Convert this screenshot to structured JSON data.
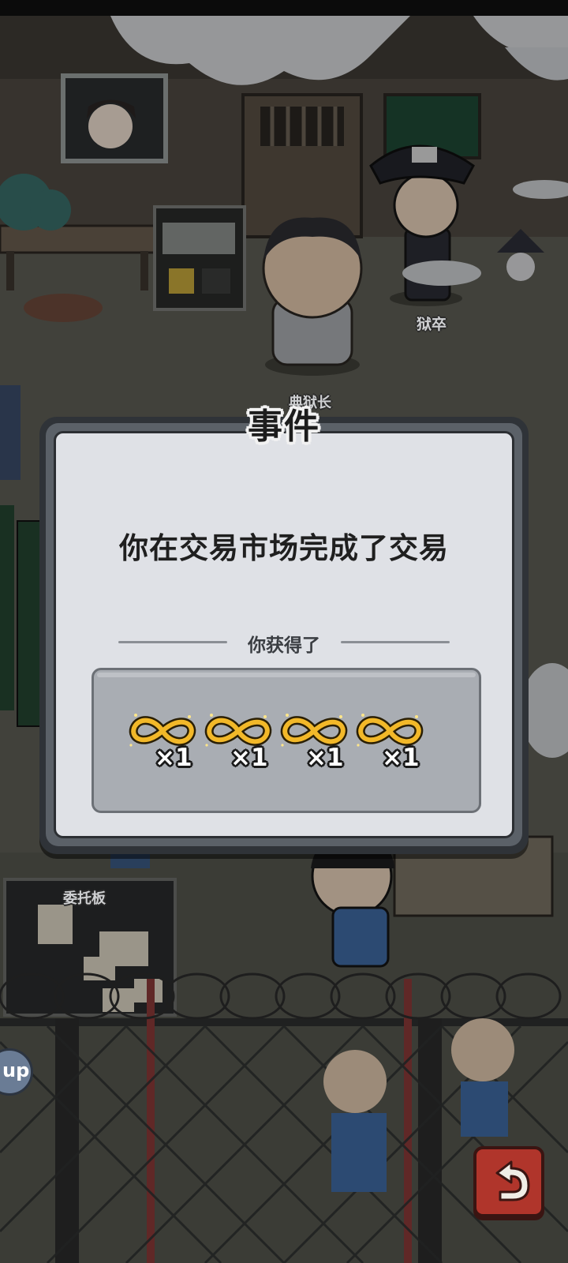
{
  "scene": {
    "guard_label": "狱卒",
    "warden_label": "典狱长",
    "board_label": "委托板",
    "up_button_label": "up"
  },
  "dialog": {
    "title": "事件",
    "message": "你在交易市场完成了交易",
    "reward_header": "你获得了",
    "rewards": [
      {
        "icon": "infinity-token-icon",
        "quantity": "×1"
      },
      {
        "icon": "infinity-token-icon",
        "quantity": "×1"
      },
      {
        "icon": "infinity-token-icon",
        "quantity": "×1"
      },
      {
        "icon": "infinity-token-icon",
        "quantity": "×1"
      }
    ]
  },
  "colors": {
    "dialog_background": "#dfe1e6",
    "dialog_frame": "#2f3338",
    "reward_panel": "#a9adb3",
    "reward_gold": "#f2b829",
    "back_button": "#b0352b"
  }
}
